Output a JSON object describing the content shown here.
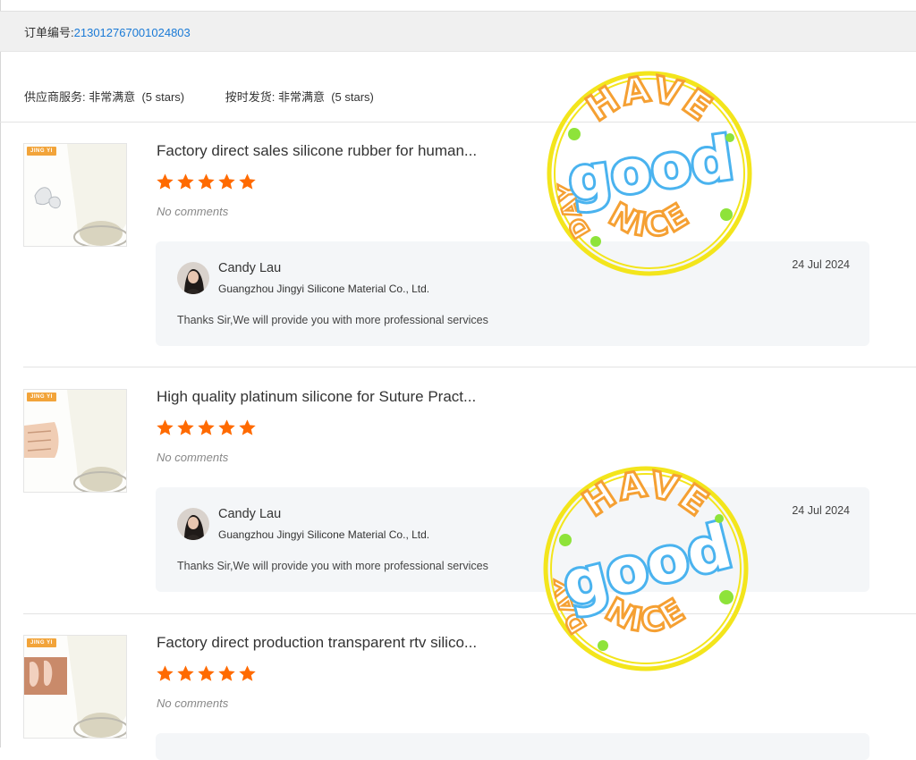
{
  "order": {
    "label": "订单编号:",
    "number": "213012767001024803"
  },
  "ratings": [
    {
      "label": "供应商服务: 非常满意  (5 stars)"
    },
    {
      "label": "按时发货: 非常满意  (5 stars)"
    }
  ],
  "reviews": [
    {
      "title": "Factory direct sales silicone rubber for human...",
      "thumb_brand": "JING YI",
      "stars": 5,
      "comment": "No comments",
      "reply": {
        "name": "Candy Lau",
        "company": "Guangzhou Jingyi Silicone Material Co., Ltd.",
        "date": "24 Jul 2024",
        "text": "Thanks Sir,We will provide you with more professional services"
      }
    },
    {
      "title": "High quality platinum silicone for Suture Pract...",
      "thumb_brand": "JING YI",
      "stars": 5,
      "comment": "No comments",
      "reply": {
        "name": "Candy Lau",
        "company": "Guangzhou Jingyi Silicone Material Co., Ltd.",
        "date": "24 Jul 2024",
        "text": "Thanks Sir,We will provide you with more professional services"
      }
    },
    {
      "title": "Factory direct production transparent rtv silico...",
      "thumb_brand": "JING YI",
      "stars": 5,
      "comment": "No comments"
    }
  ],
  "stamp": {
    "top_word": "HAVE",
    "middle_word": "good",
    "bottom_word": "NICE",
    "side_word": "DAY"
  },
  "colors": {
    "link": "#1a7ad6",
    "star": "#ff6a00",
    "stamp_ring": "#f3e51c",
    "stamp_text": "#f5a033",
    "stamp_good": "#4ab3ef",
    "stamp_dot": "#8ee33a"
  }
}
